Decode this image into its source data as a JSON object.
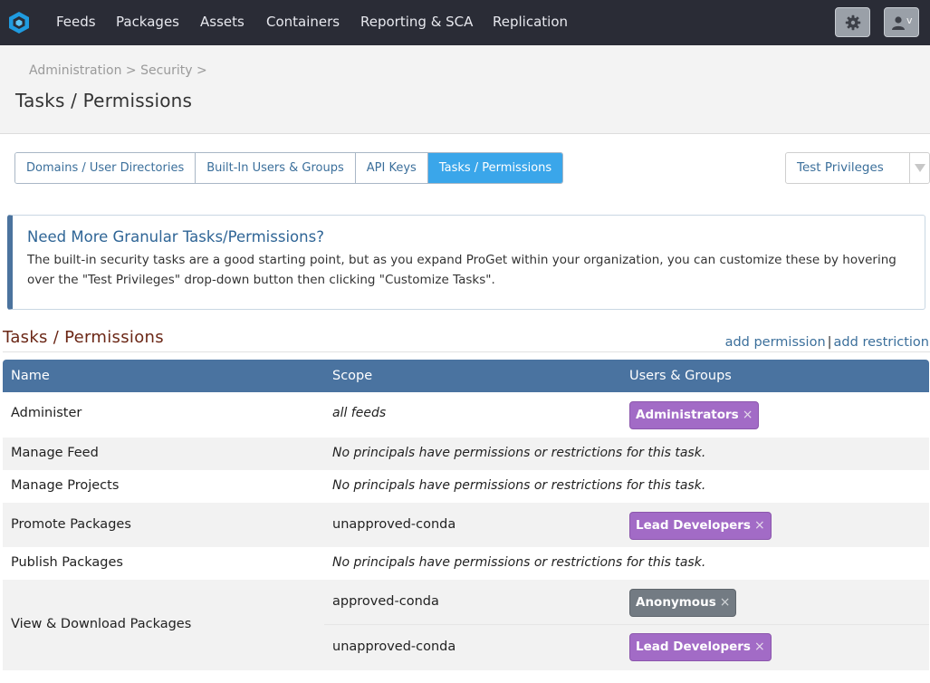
{
  "nav": {
    "items": [
      "Feeds",
      "Packages",
      "Assets",
      "Containers",
      "Reporting & SCA",
      "Replication"
    ],
    "settings_icon": "gear-icon",
    "user_icon": "user-icon",
    "user_menu_caret": "v"
  },
  "header": {
    "breadcrumb": "Administration > Security >",
    "title": "Tasks / Permissions"
  },
  "tabs": [
    {
      "label": "Domains / User Directories",
      "active": false
    },
    {
      "label": "Built-In Users & Groups",
      "active": false
    },
    {
      "label": "API Keys",
      "active": false
    },
    {
      "label": "Tasks / Permissions",
      "active": true
    }
  ],
  "privileges_button": {
    "label": "Test Privileges"
  },
  "info": {
    "title": "Need More Granular Tasks/Permissions?",
    "body": "The built-in security tasks are a good starting point, but as you expand ProGet within your organization, you can customize these by hovering over the \"Test Privileges\" drop-down button then clicking \"Customize Tasks\"."
  },
  "section": {
    "title": "Tasks / Permissions",
    "add_permission": "add permission",
    "separator": "|",
    "add_restriction": "add restriction"
  },
  "table": {
    "columns": [
      "Name",
      "Scope",
      "Users & Groups"
    ],
    "rows": [
      {
        "name": "Administer",
        "scope": "all feeds",
        "principal": "Administrators"
      },
      {
        "name": "Manage Feed",
        "note": "No principals have permissions or restrictions for this task."
      },
      {
        "name": "Manage Projects",
        "note": "No principals have permissions or restrictions for this task."
      },
      {
        "name": "Promote Packages",
        "scope": "unapproved-conda",
        "principal": "Lead Developers"
      },
      {
        "name": "Publish Packages",
        "note": "No principals have permissions or restrictions for this task."
      },
      {
        "name": "View & Download Packages",
        "sub": [
          {
            "scope": "approved-conda",
            "principal": "Anonymous"
          },
          {
            "scope": "unapproved-conda",
            "principal": "Lead Developers"
          }
        ]
      }
    ],
    "remove_glyph": "×"
  },
  "colors": {
    "topnav": "#2a2c36",
    "accent": "#3aa6ea",
    "table_header": "#4a73a0",
    "badge_purple": "#a26bc6",
    "badge_gray": "#737b83",
    "section_title": "#6b2716"
  }
}
